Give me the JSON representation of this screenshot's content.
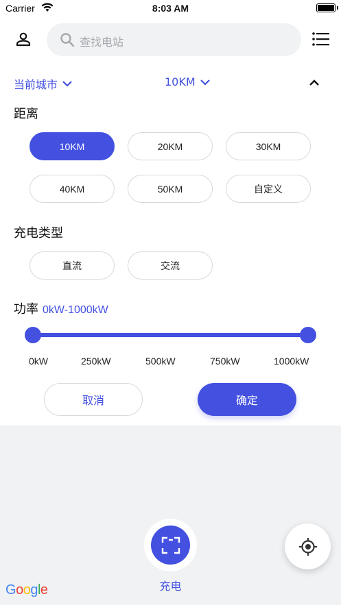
{
  "status_bar": {
    "carrier": "Carrier",
    "time": "8:03 AM"
  },
  "header": {
    "search_placeholder": "查找电站",
    "icons": {
      "user": "user-icon",
      "search": "search-icon",
      "menu": "list-menu-icon"
    }
  },
  "filters": {
    "city_label": "当前城市",
    "distance_label": "10KM"
  },
  "distance_section": {
    "title": "距离",
    "options": [
      "10KM",
      "20KM",
      "30KM",
      "40KM",
      "50KM",
      "自定义"
    ],
    "selected": "10KM"
  },
  "charge_type_section": {
    "title": "充电类型",
    "options": [
      "直流",
      "交流"
    ]
  },
  "power_section": {
    "title": "功率",
    "value": "0kW-1000kW",
    "range_min": 0,
    "range_max": 1000,
    "ticks": [
      "0kW",
      "250kW",
      "500kW",
      "750kW",
      "1000kW"
    ]
  },
  "actions": {
    "cancel": "取消",
    "confirm": "确定"
  },
  "map": {
    "charge_label": "充电",
    "google": [
      "G",
      "o",
      "o",
      "g",
      "l",
      "e"
    ]
  },
  "colors": {
    "accent": "#4350e0",
    "border": "#d9d9d9",
    "map_bg": "#f1f2f4"
  }
}
